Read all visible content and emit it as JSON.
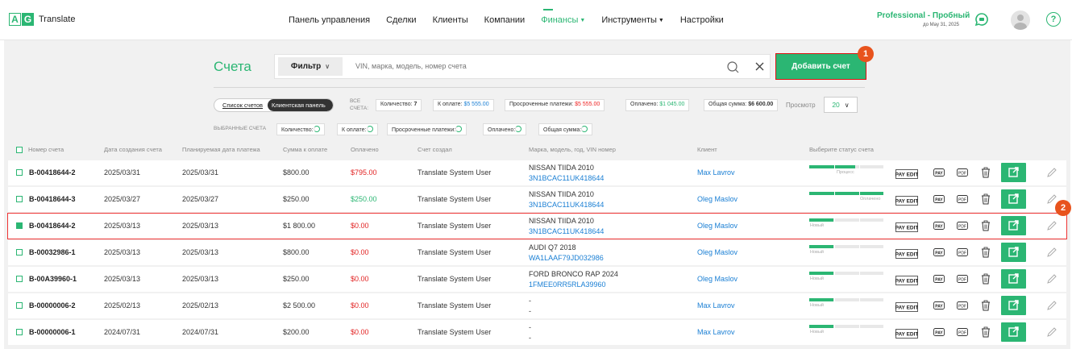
{
  "brand": {
    "letter1": "A",
    "letter2": "G",
    "name": "Translate"
  },
  "nav": [
    "Панель управления",
    "Сделки",
    "Клиенты",
    "Компании",
    "Финансы",
    "Инструменты",
    "Настройки"
  ],
  "plan": {
    "label": "Professional - Пробный",
    "date": "до May 31, 2025"
  },
  "help": "?",
  "page": {
    "title": "Счета"
  },
  "search": {
    "filter_label": "Фильтр",
    "placeholder": "VIN, марка, модель, номер счета"
  },
  "add_button": "Добавить счет",
  "badges": [
    "1",
    "2"
  ],
  "toggle": {
    "list": "Список счетов",
    "client": "Клиентская панель"
  },
  "all_label": "ВСЕ СЧЕТА:",
  "summary": [
    {
      "label": "Количество:",
      "value": "7"
    },
    {
      "label": "К оплате:",
      "value": "$5 555.00"
    },
    {
      "label": "Просроченные платежи:",
      "value": "$5 555.00"
    },
    {
      "label": "Оплачено:",
      "value": "$1 045.00"
    },
    {
      "label": "Общая сумма:",
      "value": "$6 600.00"
    }
  ],
  "view": {
    "label": "Просмотр",
    "value": "20"
  },
  "selected_label": "ВЫБРАННЫЕ СЧЕТА",
  "selected": [
    "Количество:",
    "К оплате:",
    "Просроченные платежи:",
    "Оплачено:",
    "Общая сумма:"
  ],
  "columns": [
    "Номер счета",
    "Дата создания счета",
    "Планируемая дата платежа",
    "Сумма к оплате",
    "Оплачено",
    "Счет создал",
    "Марка, модель, год, VIN номер",
    "Клиент",
    "Выберите статус счета"
  ],
  "rows": [
    {
      "num": "B-00418644-2",
      "created": "2025/03/31",
      "due": "2025/03/31",
      "amount": "$800.00",
      "paid": "$795.00",
      "paid_color": "red",
      "creator": "Translate System User",
      "vehicle": "NISSAN TIIDA 2010",
      "vin": "3N1BCAC11UK418644",
      "client": "Max Lavrov",
      "status": "Процесс",
      "progress": 0.62,
      "checked": false
    },
    {
      "num": "B-00418644-3",
      "created": "2025/03/27",
      "due": "2025/03/27",
      "amount": "$250.00",
      "paid": "$250.00",
      "paid_color": "green",
      "creator": "Translate System User",
      "vehicle": "NISSAN TIIDA 2010",
      "vin": "3N1BCAC11UK418644",
      "client": "Oleg Maslov",
      "status": "Оплачено",
      "progress": 1,
      "checked": false
    },
    {
      "num": "B-00418644-2",
      "created": "2025/03/13",
      "due": "2025/03/13",
      "amount": "$1 800.00",
      "paid": "$0.00",
      "paid_color": "red",
      "creator": "Translate System User",
      "vehicle": "NISSAN TIIDA 2010",
      "vin": "3N1BCAC11UK418644",
      "client": "Oleg Maslov",
      "status": "Новый",
      "progress": 0.33,
      "checked": true
    },
    {
      "num": "B-00032986-1",
      "created": "2025/03/13",
      "due": "2025/03/13",
      "amount": "$800.00",
      "paid": "$0.00",
      "paid_color": "red",
      "creator": "Translate System User",
      "vehicle": "AUDI Q7 2018",
      "vin": "WA1LAAF79JD032986",
      "client": "Oleg Maslov",
      "status": "Новый",
      "progress": 0.33,
      "checked": false
    },
    {
      "num": "B-00A39960-1",
      "created": "2025/03/13",
      "due": "2025/03/13",
      "amount": "$250.00",
      "paid": "$0.00",
      "paid_color": "red",
      "creator": "Translate System User",
      "vehicle": "FORD BRONCO RAP 2024",
      "vin": "1FMEE0RR5RLA39960",
      "client": "Oleg Maslov",
      "status": "Новый",
      "progress": 0.33,
      "checked": false
    },
    {
      "num": "B-00000006-2",
      "created": "2025/02/13",
      "due": "2025/02/13",
      "amount": "$2 500.00",
      "paid": "$0.00",
      "paid_color": "red",
      "creator": "Translate System User",
      "vehicle": "-",
      "vin": "-",
      "client": "Max Lavrov",
      "status": "Новый",
      "progress": 0.33,
      "checked": false
    },
    {
      "num": "B-00000006-1",
      "created": "2024/07/31",
      "due": "2024/07/31",
      "amount": "$200.00",
      "paid": "$0.00",
      "paid_color": "red",
      "creator": "Translate System User",
      "vehicle": "-",
      "vin": "-",
      "client": "Max Lavrov",
      "status": "Новый",
      "progress": 0.33,
      "checked": false
    }
  ],
  "row_actions": {
    "pay_edit": "PAY EDIT",
    "pay": "PAY",
    "pdf": "PDF"
  },
  "colors": {
    "accent": "#2bb673",
    "red": "#e22222",
    "link": "#1a7fd4",
    "badge": "#e8531d"
  }
}
